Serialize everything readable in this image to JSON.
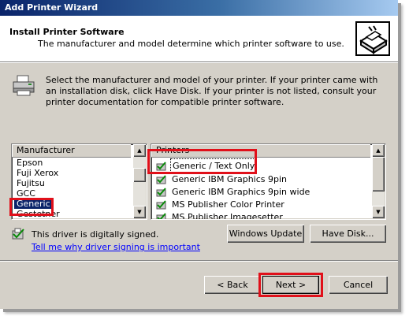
{
  "window": {
    "title": "Add Printer Wizard"
  },
  "header": {
    "title": "Install Printer Software",
    "subtitle": "The manufacturer and model determine which printer software to use."
  },
  "instructions": "Select the manufacturer and model of your printer. If your printer came with an installation disk, click Have Disk. If your printer is not listed, consult your printer documentation for compatible printer software.",
  "manufacturer_list": {
    "header": "Manufacturer",
    "items": [
      "Epson",
      "Fuji Xerox",
      "Fujitsu",
      "GCC",
      "Generic",
      "Gestetner"
    ],
    "selected": "Generic"
  },
  "printers_list": {
    "header": "Printers",
    "items": [
      "Generic / Text Only",
      "Generic IBM Graphics 9pin",
      "Generic IBM Graphics 9pin wide",
      "MS Publisher Color Printer",
      "MS Publisher Imagesetter"
    ],
    "selected": "Generic / Text Only"
  },
  "signed": {
    "text": "This driver is digitally signed.",
    "link": "Tell me why driver signing is important"
  },
  "buttons": {
    "windows_update": "Windows Update",
    "have_disk": "Have Disk...",
    "back": "< Back",
    "next": "Next >",
    "cancel": "Cancel"
  },
  "colors": {
    "highlight": "#e0101a",
    "selection": "#0a246a",
    "link": "#0000ff"
  }
}
